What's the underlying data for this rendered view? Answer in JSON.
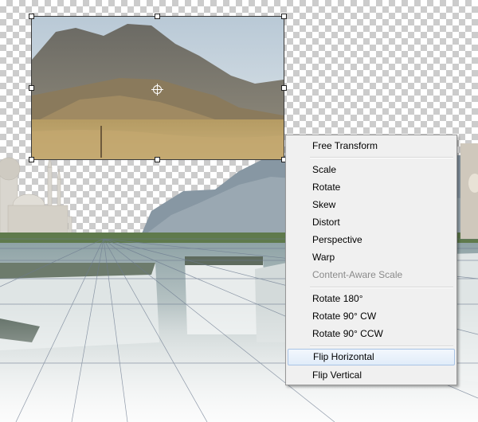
{
  "context_menu": {
    "free_transform": "Free Transform",
    "scale": "Scale",
    "rotate": "Rotate",
    "skew": "Skew",
    "distort": "Distort",
    "perspective": "Perspective",
    "warp": "Warp",
    "content_aware_scale": "Content-Aware Scale",
    "rotate_180": "Rotate 180°",
    "rotate_90_cw": "Rotate 90° CW",
    "rotate_90_ccw": "Rotate 90° CCW",
    "flip_horizontal": "Flip Horizontal",
    "flip_vertical": "Flip Vertical",
    "highlighted_item": "Flip Horizontal",
    "disabled_item": "Content-Aware Scale"
  },
  "document": {
    "transparency_grid": true,
    "selected_layer": "mountain-landscape-photo",
    "background_image": "waterfall-mosque-composite"
  },
  "colors": {
    "menu_background": "#f0f0f0",
    "menu_highlight": "#e1ecf9",
    "menu_disabled_text": "#8a8a8a"
  }
}
